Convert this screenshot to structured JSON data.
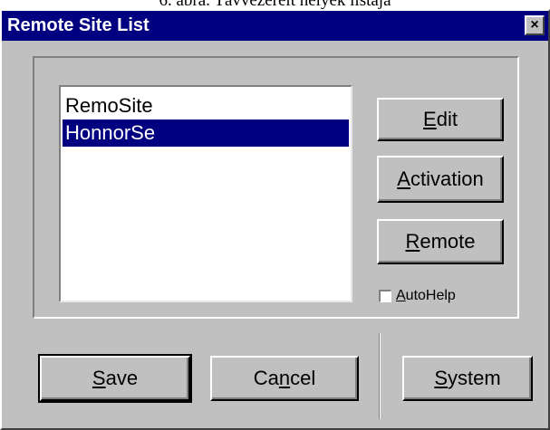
{
  "caption": "6. ábra. Távvezérelt helyek listája",
  "window": {
    "title": "Remote Site List",
    "close_glyph": "×"
  },
  "list": {
    "items": [
      {
        "label": "RemoSite",
        "selected": false
      },
      {
        "label": "HonnorSe",
        "selected": true
      }
    ]
  },
  "buttons": {
    "edit": {
      "pre": "",
      "u": "E",
      "post": "dit"
    },
    "activation": {
      "pre": "",
      "u": "A",
      "post": "ctivation"
    },
    "remote": {
      "pre": "",
      "u": "R",
      "post": "emote"
    },
    "save": {
      "pre": "",
      "u": "S",
      "post": "ave"
    },
    "cancel": {
      "pre": "Ca",
      "u": "n",
      "post": "cel"
    },
    "system": {
      "pre": "",
      "u": "S",
      "post": "ystem"
    }
  },
  "autohelp": {
    "pre": "",
    "u": "A",
    "post": "utoHelp",
    "checked": false
  },
  "colors": {
    "titlebar": "#000080",
    "face": "#c0c0c0",
    "selection": "#000080"
  }
}
